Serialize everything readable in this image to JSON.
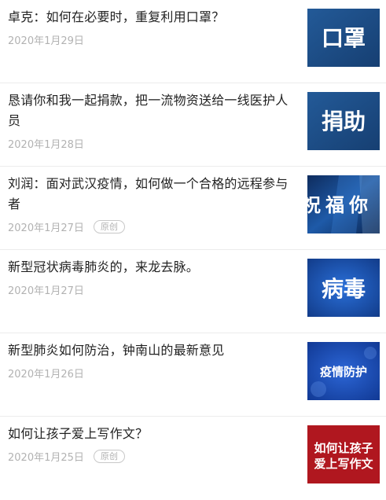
{
  "articles": [
    {
      "title": "卓克：如何在必要时，重复利用口罩？",
      "date": "2020年1月29日",
      "thumb": {
        "lines": [
          "口罩"
        ],
        "bg": "#1d4f8b"
      }
    },
    {
      "title": "恳请你和我一起捐款，把一流物资送给一线医护人员",
      "date": "2020年1月28日",
      "thumb": {
        "lines": [
          "捐助"
        ],
        "bg": "#1d4f8b"
      }
    },
    {
      "title": "刘润：面对武汉疫情，如何做一个合格的远程参与者",
      "date": "2020年1月27日",
      "badge": "原创",
      "thumb": {
        "lines": [
          "祝福你"
        ],
        "bg": "#123c78"
      }
    },
    {
      "title": "新型冠状病毒肺炎的，来龙去脉。",
      "date": "2020年1月27日",
      "thumb": {
        "lines": [
          "病毒"
        ],
        "bg": "#1a55b8"
      }
    },
    {
      "title": "新型肺炎如何防治，钟南山的最新意见",
      "date": "2020年1月26日",
      "thumb": {
        "lines": [
          "疫情防护"
        ],
        "bg": "#1546a8"
      }
    },
    {
      "title": "如何让孩子爱上写作文？",
      "date": "2020年1月25日",
      "badge": "原创",
      "thumb": {
        "lines": [
          "如何让孩子",
          "爱上写作文"
        ],
        "bg": "#b0171f"
      }
    }
  ]
}
